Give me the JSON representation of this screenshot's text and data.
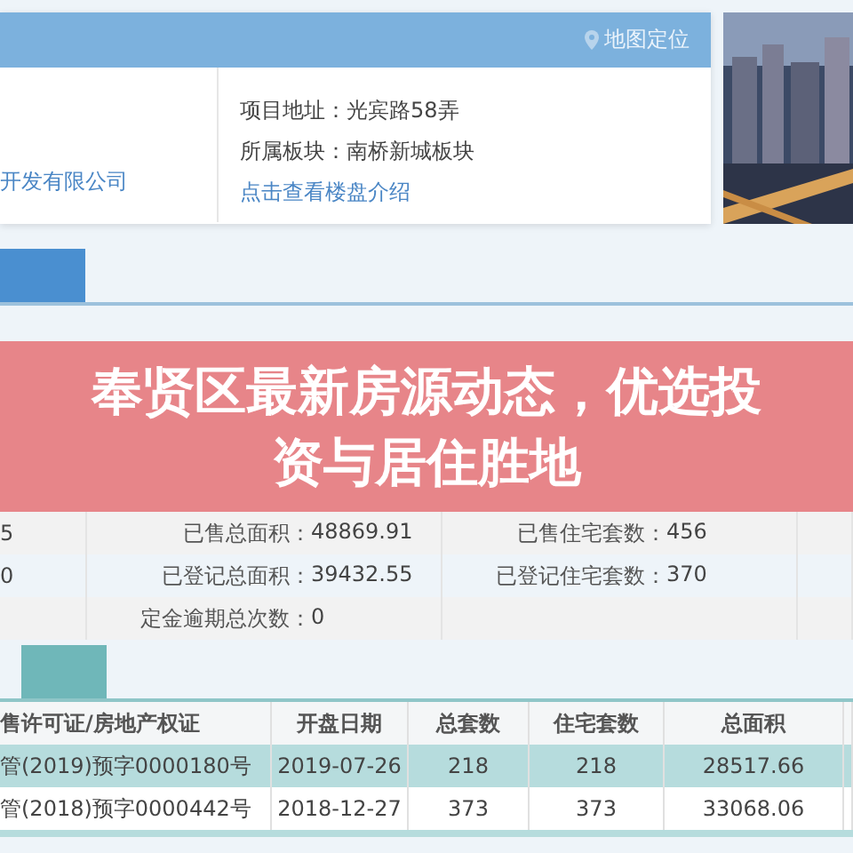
{
  "header": {
    "map_link": "地图定位"
  },
  "project": {
    "developer": "开发有限公司",
    "address": "项目地址：光宾路58弄",
    "block": "所属板块：南桥新城板块",
    "intro_link": "点击查看楼盘介绍"
  },
  "banner": {
    "title": "奉贤区最新房源动态，优选投资与居住胜地"
  },
  "stats": [
    {
      "column_1": "5",
      "label_a": "已售总面积：",
      "value_a": "48869.91",
      "label_b": "已售住宅套数：",
      "value_b": "456"
    },
    {
      "column_1": "0",
      "label_a": "已登记总面积：",
      "value_a": "39432.55",
      "label_b": "已登记住宅套数：",
      "value_b": "370"
    },
    {
      "label_a": "定金逾期总次数：",
      "value_a": "0"
    }
  ],
  "table": {
    "columns": [
      "售许可证/房地产权证",
      "开盘日期",
      "总套数",
      "住宅套数",
      "总面积"
    ],
    "rows": [
      {
        "selected": true,
        "cells": [
          "管(2019)预字0000180号",
          "2019-07-26",
          "218",
          "218",
          "28517.66"
        ]
      },
      {
        "selected": false,
        "cells": [
          "管(2018)预字0000442号",
          "2018-12-27",
          "373",
          "373",
          "33068.06"
        ]
      }
    ]
  }
}
